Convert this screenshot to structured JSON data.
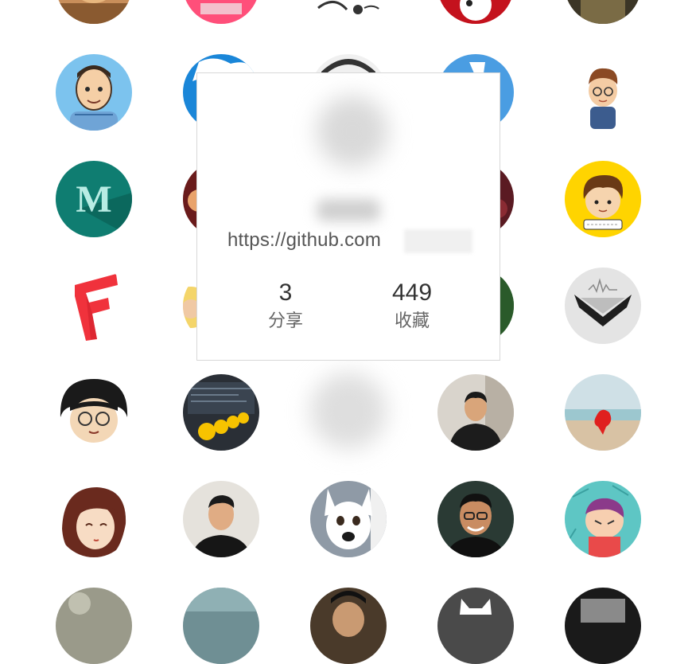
{
  "profile_card": {
    "url_text": "https://github.com",
    "stats": {
      "share_count": "3",
      "share_label": "分享",
      "favorites_count": "449",
      "favorites_label": "收藏"
    }
  },
  "avatars": {
    "letter_m": "M"
  },
  "colors": {
    "card_border": "#d8d8d8",
    "teal_m": "#0f7d71",
    "red_logo": "#f0323c",
    "yellow_avatar_bg": "#ffd400",
    "blue_avatar_bg": "#4a9de2"
  }
}
